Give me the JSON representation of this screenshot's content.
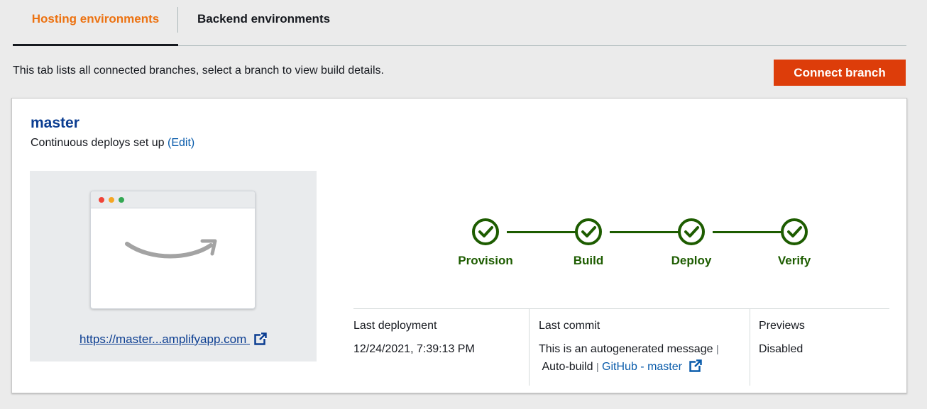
{
  "tabs": {
    "hosting_label": "Hosting environments",
    "backend_label": "Backend environments"
  },
  "description": "This tab lists all connected branches, select a branch to view build details.",
  "connect_button_label": "Connect branch",
  "branch": {
    "name": "master",
    "deploy_text": "Continuous deploys set up",
    "edit_label": "(Edit)",
    "url": "https://master...amplifyapp.com"
  },
  "pipeline": {
    "steps": [
      "Provision",
      "Build",
      "Deploy",
      "Verify"
    ],
    "status_color": "#1d5c00"
  },
  "info": {
    "last_deployment_label": "Last deployment",
    "last_deployment_value": "12/24/2021, 7:39:13 PM",
    "last_commit_label": "Last commit",
    "last_commit_message": "This is an autogenerated message",
    "last_commit_sep1": "|",
    "last_commit_autobuild": "Auto-build",
    "last_commit_sep2": "|",
    "last_commit_link": "GitHub - master",
    "previews_label": "Previews",
    "previews_value": "Disabled"
  },
  "colors": {
    "accent_orange": "#ec7211",
    "button_red": "#dd3d0a",
    "link_blue": "#0a5cab",
    "title_blue": "#0b3d91"
  },
  "icons": [
    "check-circle-icon",
    "external-link-icon",
    "amazon-smile-icon"
  ]
}
